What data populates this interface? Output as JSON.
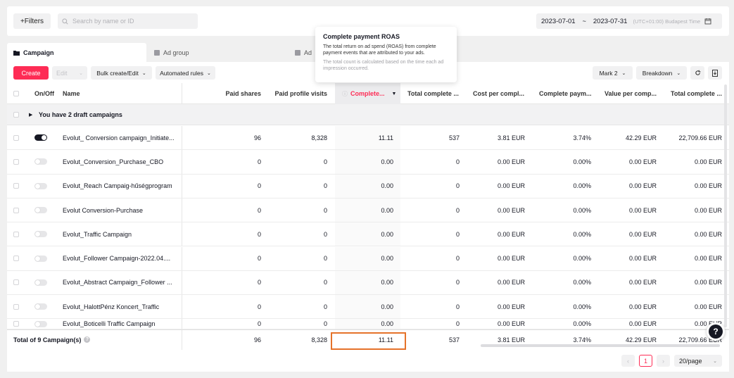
{
  "toolbar": {
    "filters_label": "+Filters",
    "search_placeholder": "Search by name or ID",
    "date_start": "2023-07-01",
    "date_sep": "~",
    "date_end": "2023-07-31",
    "timezone": "(UTC+01:00) Budapest Time"
  },
  "tabs": [
    {
      "label": "Campaign",
      "active": true
    },
    {
      "label": "Ad group",
      "active": false
    },
    {
      "label": "Ad",
      "active": false
    }
  ],
  "actions": {
    "create": "Create",
    "edit": "Edit",
    "bulk": "Bulk create/Edit",
    "rules": "Automated rules",
    "mark": "Mark 2",
    "breakdown": "Breakdown"
  },
  "tooltip": {
    "title": "Complete payment ROAS",
    "body": "The total return on ad spend (ROAS) from complete payment events that are attributed to your ads.",
    "note": "The total count is calculated based on the time each ad impression occurred."
  },
  "table": {
    "headers": {
      "onoff": "On/Off",
      "name": "Name",
      "paid_shares": "Paid shares",
      "paid_profile": "Paid profile visits",
      "complete_roas": "Complete...",
      "total_complete": "Total complete ...",
      "cost_per": "Cost per compl...",
      "complete_pay": "Complete paym...",
      "value_per": "Value per comp...",
      "total_complete2": "Total complete ..."
    },
    "draft_label": "You have 2 draft campaigns",
    "rows": [
      {
        "on": true,
        "name": "Evolut_ Conversion campaign_Initiate...",
        "shares": "96",
        "visits": "8,328",
        "roas": "11.11",
        "total": "537",
        "cost": "3.81 EUR",
        "rate": "3.74%",
        "value": "42.29 EUR",
        "total2": "22,709.66 EUR"
      },
      {
        "on": false,
        "name": "Evolut_Conversion_Purchase_CBO",
        "shares": "0",
        "visits": "0",
        "roas": "0.00",
        "total": "0",
        "cost": "0.00 EUR",
        "rate": "0.00%",
        "value": "0.00 EUR",
        "total2": "0.00 EUR"
      },
      {
        "on": false,
        "name": "Evolut_Reach Campaig-hűségprogram",
        "shares": "0",
        "visits": "0",
        "roas": "0.00",
        "total": "0",
        "cost": "0.00 EUR",
        "rate": "0.00%",
        "value": "0.00 EUR",
        "total2": "0.00 EUR"
      },
      {
        "on": false,
        "name": "Evolut Conversion-Purchase",
        "shares": "0",
        "visits": "0",
        "roas": "0.00",
        "total": "0",
        "cost": "0.00 EUR",
        "rate": "0.00%",
        "value": "0.00 EUR",
        "total2": "0.00 EUR"
      },
      {
        "on": false,
        "name": "Evolut_Traffic Campaign",
        "shares": "0",
        "visits": "0",
        "roas": "0.00",
        "total": "0",
        "cost": "0.00 EUR",
        "rate": "0.00%",
        "value": "0.00 EUR",
        "total2": "0.00 EUR"
      },
      {
        "on": false,
        "name": "Evolut_Follower Campaign-2022.04....",
        "shares": "0",
        "visits": "0",
        "roas": "0.00",
        "total": "0",
        "cost": "0.00 EUR",
        "rate": "0.00%",
        "value": "0.00 EUR",
        "total2": "0.00 EUR"
      },
      {
        "on": false,
        "name": "Evolut_Abstract Campaign_Follower ...",
        "shares": "0",
        "visits": "0",
        "roas": "0.00",
        "total": "0",
        "cost": "0.00 EUR",
        "rate": "0.00%",
        "value": "0.00 EUR",
        "total2": "0.00 EUR"
      },
      {
        "on": false,
        "name": "Evolut_HalottPénz Koncert_Traffic",
        "shares": "0",
        "visits": "0",
        "roas": "0.00",
        "total": "0",
        "cost": "0.00 EUR",
        "rate": "0.00%",
        "value": "0.00 EUR",
        "total2": "0.00 EUR"
      },
      {
        "on": false,
        "name": "Evolut_Boticelli Traffic Campaign",
        "shares": "0",
        "visits": "0",
        "roas": "0.00",
        "total": "0",
        "cost": "0.00 EUR",
        "rate": "0.00%",
        "value": "0.00 EUR",
        "total2": "0.00 EUR"
      }
    ],
    "total": {
      "label": "Total of 9 Campaign(s)",
      "shares": "96",
      "visits": "8,328",
      "roas": "11.11",
      "total": "537",
      "cost": "3.81 EUR",
      "rate": "3.74%",
      "value": "42.29 EUR",
      "total2": "22,709.66 EUR"
    }
  },
  "pagination": {
    "page": "1",
    "per_page": "20/page"
  },
  "colors": {
    "accent": "#fe2c55",
    "highlight_box": "#e5722a"
  }
}
